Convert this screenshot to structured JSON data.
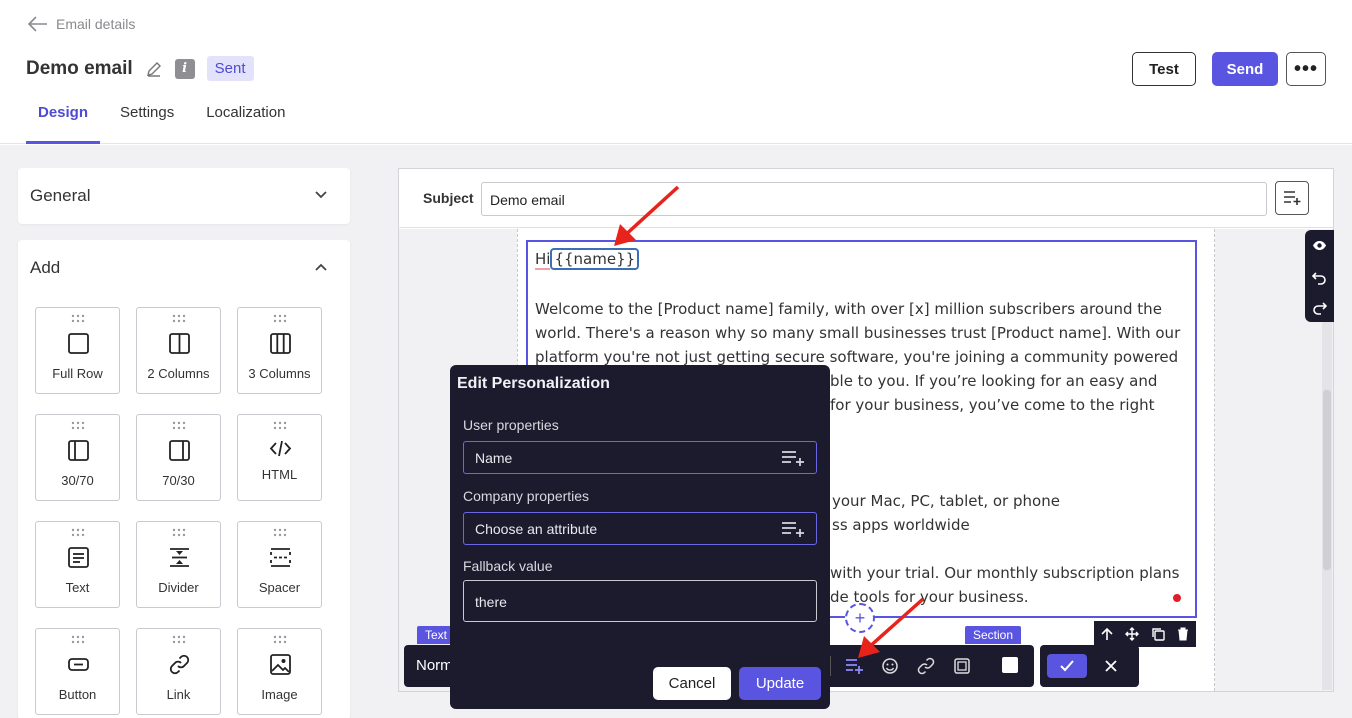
{
  "header": {
    "back_label": "Email details",
    "title": "Demo email",
    "status_badge": "Sent",
    "tabs": [
      {
        "label": "Design",
        "active": true
      },
      {
        "label": "Settings",
        "active": false
      },
      {
        "label": "Localization",
        "active": false
      }
    ],
    "test_label": "Test",
    "send_label": "Send",
    "more_label": "•••"
  },
  "sidebar": {
    "general_label": "General",
    "add_label": "Add",
    "blocks": [
      {
        "label": "Full Row",
        "icon": "full-row-icon"
      },
      {
        "label": "2 Columns",
        "icon": "two-columns-icon"
      },
      {
        "label": "3 Columns",
        "icon": "three-columns-icon"
      },
      {
        "label": "30/70",
        "icon": "layout-30-70-icon"
      },
      {
        "label": "70/30",
        "icon": "layout-70-30-icon"
      },
      {
        "label": "HTML",
        "icon": "html-code-icon"
      },
      {
        "label": "Text",
        "icon": "text-icon"
      },
      {
        "label": "Divider",
        "icon": "divider-icon"
      },
      {
        "label": "Spacer",
        "icon": "spacer-icon"
      },
      {
        "label": "Button",
        "icon": "button-icon"
      },
      {
        "label": "Link",
        "icon": "link-icon"
      },
      {
        "label": "Image",
        "icon": "image-icon"
      }
    ]
  },
  "editor": {
    "subject_label": "Subject",
    "subject_value": "Demo email",
    "greeting_hi": "Hi",
    "greeting_token": "{{name}}",
    "para1_lines": [
      "Welcome to the [Product name] family, with over [x] million subscribers around the",
      "world. There's a reason why so many small businesses trust [Product name]. With our",
      "platform you're not just getting secure software, you're joining a community powered",
      "ble to you.   If you’re looking for an easy and",
      "for your business, you’ve come to the right"
    ],
    "para2_lines": [
      "your Mac, PC, tablet, or phone",
      "ss apps worldwide"
    ],
    "para3_lines": [
      "with your trial. Our monthly subscription plans",
      "de tools for your business."
    ],
    "text_tag": "Text",
    "section_tag": "Section",
    "toolbar_label": "Norm"
  },
  "modal": {
    "title": "Edit Personalization",
    "user_properties_label": "User properties",
    "user_properties_value": "Name",
    "company_properties_label": "Company properties",
    "company_properties_placeholder": "Choose an attribute",
    "fallback_label": "Fallback value",
    "fallback_value": "there",
    "cancel_label": "Cancel",
    "update_label": "Update"
  },
  "colors": {
    "accent": "#5a55e0",
    "dark_panel": "#1c1b2e",
    "annotation_arrow": "#e8231b"
  }
}
